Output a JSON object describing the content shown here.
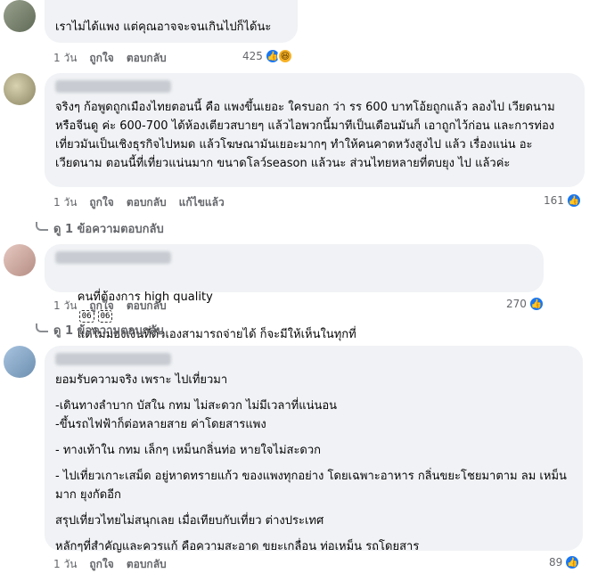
{
  "comments": [
    {
      "text": "เราไม่ได้แพง แต่คุณอาจจะจนเกินไปก็ได้นะ",
      "time": "1 วัน",
      "like": "ถูกใจ",
      "reply": "ตอบกลับ",
      "reactions": "425",
      "reaction_icons": [
        "like-icon",
        "haha-icon"
      ]
    },
    {
      "paragraph": "จริงๆ ก้อพูดถูกเมืองไทยตอนนี้ คือ แพงขึ้นเยอะ ใครบอก ว่า รร 600 บาทโอ้ยถูกแล้ว ลองไป เวียดนามหรือจีนดู ค่ะ 600-700 ได้ห้องเตียวสบายๆ แล้วไอพวกนี้มาทีเป็นเดือนมันก็ เอาถูกไว้ก่อน และการท่องเที่ยวมันเป็นเชิงธุรกิจไปหมด แล้วโฆษณามันเยอะมากๆ ทำให้คนคาดหวังสูงไป แล้ว เรื่องแน่น อะ เวียดนาม ตอนนี้ที่เที่ยวแน่นมาก ขนาดโลว์season แล้วนะ ส่วนไทยหลายที่ตบยุง ไป แล้วค่ะ",
      "time": "1 วัน",
      "like": "ถูกใจ",
      "reply": "ตอบกลับ",
      "edited": "แก้ไขแล้ว",
      "reactions": "161",
      "view_replies": "ดู 1 ข้อความตอบกลับ"
    },
    {
      "text_before": "คนที่ต้องการ high quality",
      "pill_a": "06",
      "pill_b": "06",
      "text_after": "แต่ไม่มองเงินที่ตัวเองสามารถจ่ายได้ ก็จะมีให้เห็นในทุกที่",
      "time": "1 วัน",
      "like": "ถูกใจ",
      "reply": "ตอบกลับ",
      "reactions": "270",
      "view_replies": "ดู 1 ข้อความตอบกลับ"
    },
    {
      "paragraphs": [
        "ยอมรับความจริง เพราะ ไปเที่ยวมา",
        "-เดินทางลำบาก บัสใน กทม ไม่สะดวก ไม่มีเวลาที่แน่นอน\n-ขึ้นรถไฟฟ้าก็ต่อหลายสาย ค่าโดยสารแพง",
        "- ทางเท้าใน กทม เล็กๆ เหม็นกลิ่นท่อ หายใจไม่สะดวก",
        "- ไปเที่ยวเกาะเสม็ด อยู่หาดทรายแก้ว ของแพงทุกอย่าง โดยเฉพาะอาหาร กลิ่นขยะโชยมาตาม ลม เหม็นมาก ยุงกัดอีก",
        "สรุปเที่ยวไทยไม่สนุกเลย เมื่อเทียบกับเที่ยว ต่างประเทศ",
        "หลักๆที่สำคัญและควรแก้ คือความสะอาด ขยะเกลื่อน ท่อเหม็น รถโดยสาร"
      ],
      "time": "1 วัน",
      "like": "ถูกใจ",
      "reply": "ตอบกลับ",
      "reactions": "89"
    }
  ],
  "colors": {
    "bubble": "#f0f2f5",
    "meta": "#65676b",
    "like": "#1877f2",
    "haha": "#f7b125"
  }
}
